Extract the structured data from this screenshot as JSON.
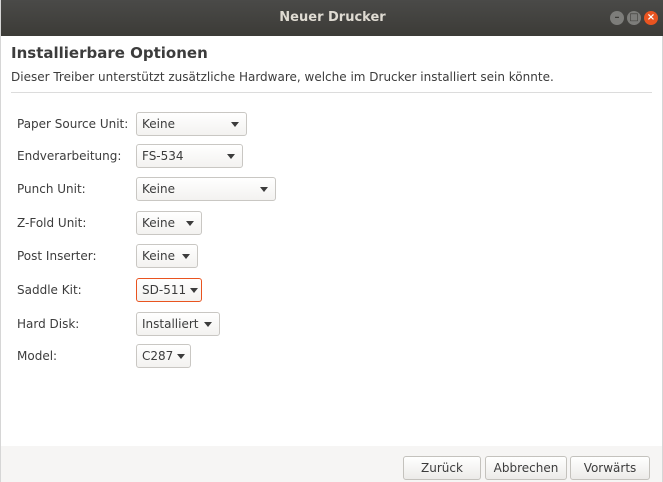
{
  "window": {
    "title": "Neuer Drucker"
  },
  "page": {
    "heading": "Installierbare Optionen",
    "description": "Dieser Treiber unterstützt zusätzliche Hardware, welche im Drucker installiert sein könnte."
  },
  "options": [
    {
      "label": "Paper Source Unit:",
      "value": "Keine"
    },
    {
      "label": "Endverarbeitung:",
      "value": "FS-534"
    },
    {
      "label": "Punch Unit:",
      "value": "Keine"
    },
    {
      "label": "Z-Fold Unit:",
      "value": "Keine"
    },
    {
      "label": "Post Inserter:",
      "value": "Keine"
    },
    {
      "label": "Saddle Kit:",
      "value": "SD-511"
    },
    {
      "label": "Hard Disk:",
      "value": "Installiert"
    },
    {
      "label": "Model:",
      "value": "C287"
    }
  ],
  "buttons": {
    "back": "Zurück",
    "cancel": "Abbrechen",
    "forward": "Vorwärts"
  },
  "colors": {
    "accent": "#e95420",
    "titlebar": "#3c3b37"
  }
}
